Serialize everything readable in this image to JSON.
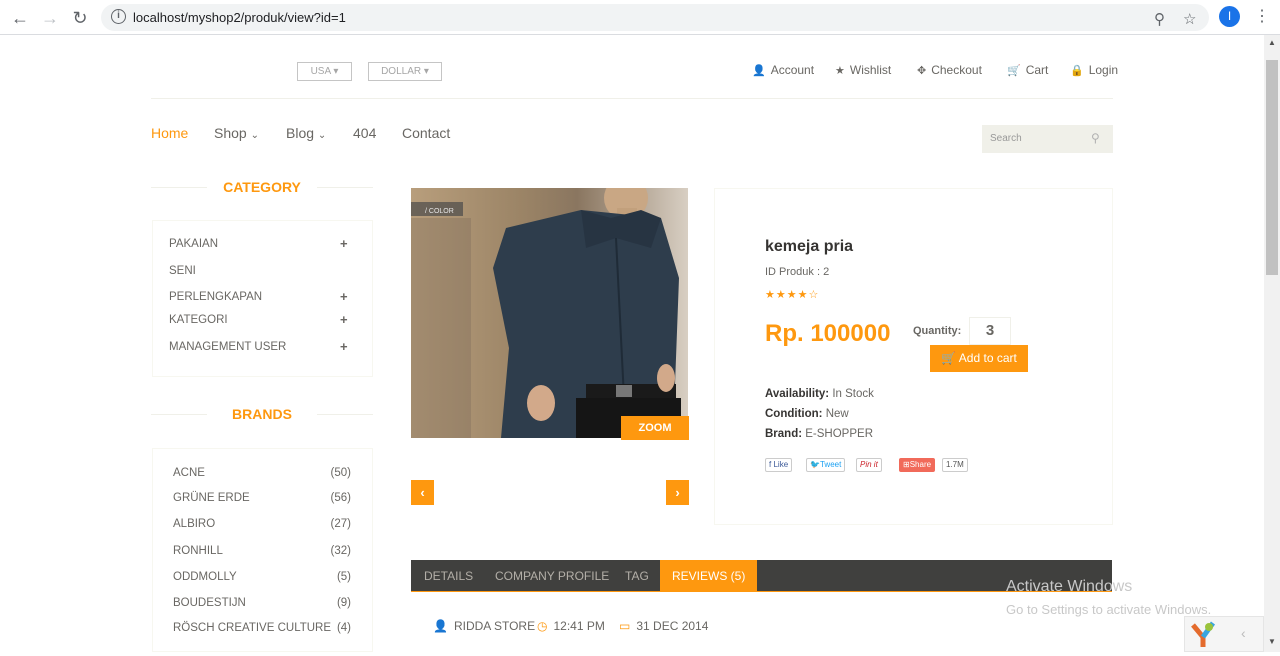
{
  "browser": {
    "url": "localhost/myshop2/produk/view?id=1",
    "profile_initial": "I"
  },
  "header": {
    "country": "USA",
    "currency": "DOLLAR",
    "account": "Account",
    "wishlist": "Wishlist",
    "checkout": "Checkout",
    "cart": "Cart",
    "login": "Login"
  },
  "nav": {
    "home": "Home",
    "shop": "Shop",
    "blog": "Blog",
    "notfound": "404",
    "contact": "Contact",
    "search_placeholder": "Search"
  },
  "sidebar": {
    "category_title": "CATEGORY",
    "categories": [
      "PAKAIAN",
      "SENI",
      "PERLENGKAPAN",
      "KATEGORI",
      "MANAGEMENT USER"
    ],
    "brands_title": "BRANDS",
    "brands": [
      {
        "name": "ACNE",
        "count": "(50)"
      },
      {
        "name": "GRÜNE ERDE",
        "count": "(56)"
      },
      {
        "name": "ALBIRO",
        "count": "(27)"
      },
      {
        "name": "RONHILL",
        "count": "(32)"
      },
      {
        "name": "ODDMOLLY",
        "count": "(5)"
      },
      {
        "name": "BOUDESTIJN",
        "count": "(9)"
      },
      {
        "name": "RÖSCH CREATIVE CULTURE",
        "count": "(4)"
      }
    ]
  },
  "product": {
    "image_caption": "/ COLOR",
    "zoom_label": "ZOOM",
    "name": "kemeja pria",
    "id_text": "ID Produk : 2",
    "rating": 4.5,
    "price": "Rp. 100000",
    "quantity_label": "Quantity:",
    "quantity": "3",
    "add_to_cart": "Add to cart",
    "availability_label": "Availability:",
    "availability": "In Stock",
    "condition_label": "Condition:",
    "condition": "New",
    "brand_label": "Brand:",
    "brand": "E-SHOPPER",
    "share": {
      "like": "Like",
      "tweet": "Tweet",
      "pin": "Pin it",
      "share": "Share",
      "count": "1.7M"
    }
  },
  "tabs": {
    "details": "DETAILS",
    "company": "COMPANY PROFILE",
    "tag": "TAG",
    "reviews": "REVIEWS (5)"
  },
  "review": {
    "store": "RIDDA STORE",
    "time": "12:41 PM",
    "date": "31 DEC 2014"
  },
  "watermark": {
    "line1": "Activate Windows",
    "line2": "Go to Settings to activate Windows."
  },
  "colors": {
    "accent": "#fe980f",
    "text": "#696763",
    "tabbar": "#40403e"
  }
}
